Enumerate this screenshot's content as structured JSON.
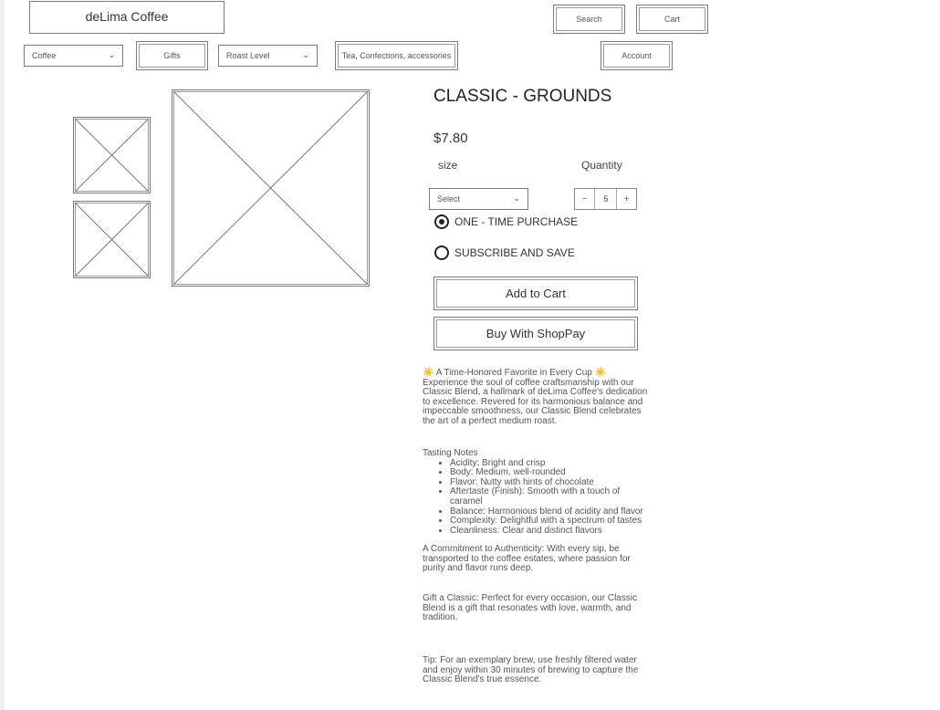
{
  "header": {
    "logo": "deLima Coffee",
    "search_label": "Search",
    "cart_label": "Cart",
    "account_label": "Account"
  },
  "nav": {
    "coffee": "Coffee",
    "gifts": "Gifts",
    "roast_level": "Roast Level",
    "tea": "Tea, Confections, accessories"
  },
  "product": {
    "title": "CLASSIC - GROUNDS",
    "price": "$7.80",
    "size_label": "size",
    "size_select": "Select",
    "quantity_label": "Quantity",
    "quantity_minus": "−",
    "quantity_value": "5",
    "quantity_plus": "+",
    "purchase_options": [
      {
        "label": "ONE - TIME PURCHASE",
        "selected": true
      },
      {
        "label": "SUBSCRIBE AND SAVE",
        "selected": false
      }
    ],
    "add_to_cart": "Add to Cart",
    "shoppay": "Buy With ShopPay"
  },
  "description": {
    "headline_icon": "☀️",
    "headline": "A Time-Honored Favorite in Every Cup",
    "intro": "Experience the soul of coffee craftsmanship with our Classic Blend, a hallmark of deLima Coffee's dedication to excellence. Revered for its harmonious balance and impeccable smoothness, our Classic Blend celebrates the art of a perfect medium roast.",
    "tasting_title": "Tasting Notes",
    "tasting_notes": [
      "Acidity: Bright and crisp",
      "Body: Medium, well-rounded",
      "Flavor: Nutty with hints of chocolate",
      "Aftertaste (Finish): Smooth with a touch of caramel",
      "Balance: Harmonious blend of acidity and flavor",
      "Complexity: Delightful with a spectrum of tastes",
      "Cleanliness: Clear and distinct flavors"
    ],
    "authenticity": "A Commitment to Authenticity: With every sip, be transported to the coffee estates, where passion for purity and flavor runs deep.",
    "gift": "Gift a Classic: Perfect for every occasion, our Classic Blend is a gift that resonates with love, warmth, and tradition.",
    "tip": "Tip: For an exemplary brew, use freshly filtered water and enjoy within 30 minutes of brewing to capture the Classic Blend's true essence."
  },
  "colors": {
    "border": "#7a7a7a",
    "text": "#333333",
    "muted": "#555555",
    "radio": "#222222"
  }
}
